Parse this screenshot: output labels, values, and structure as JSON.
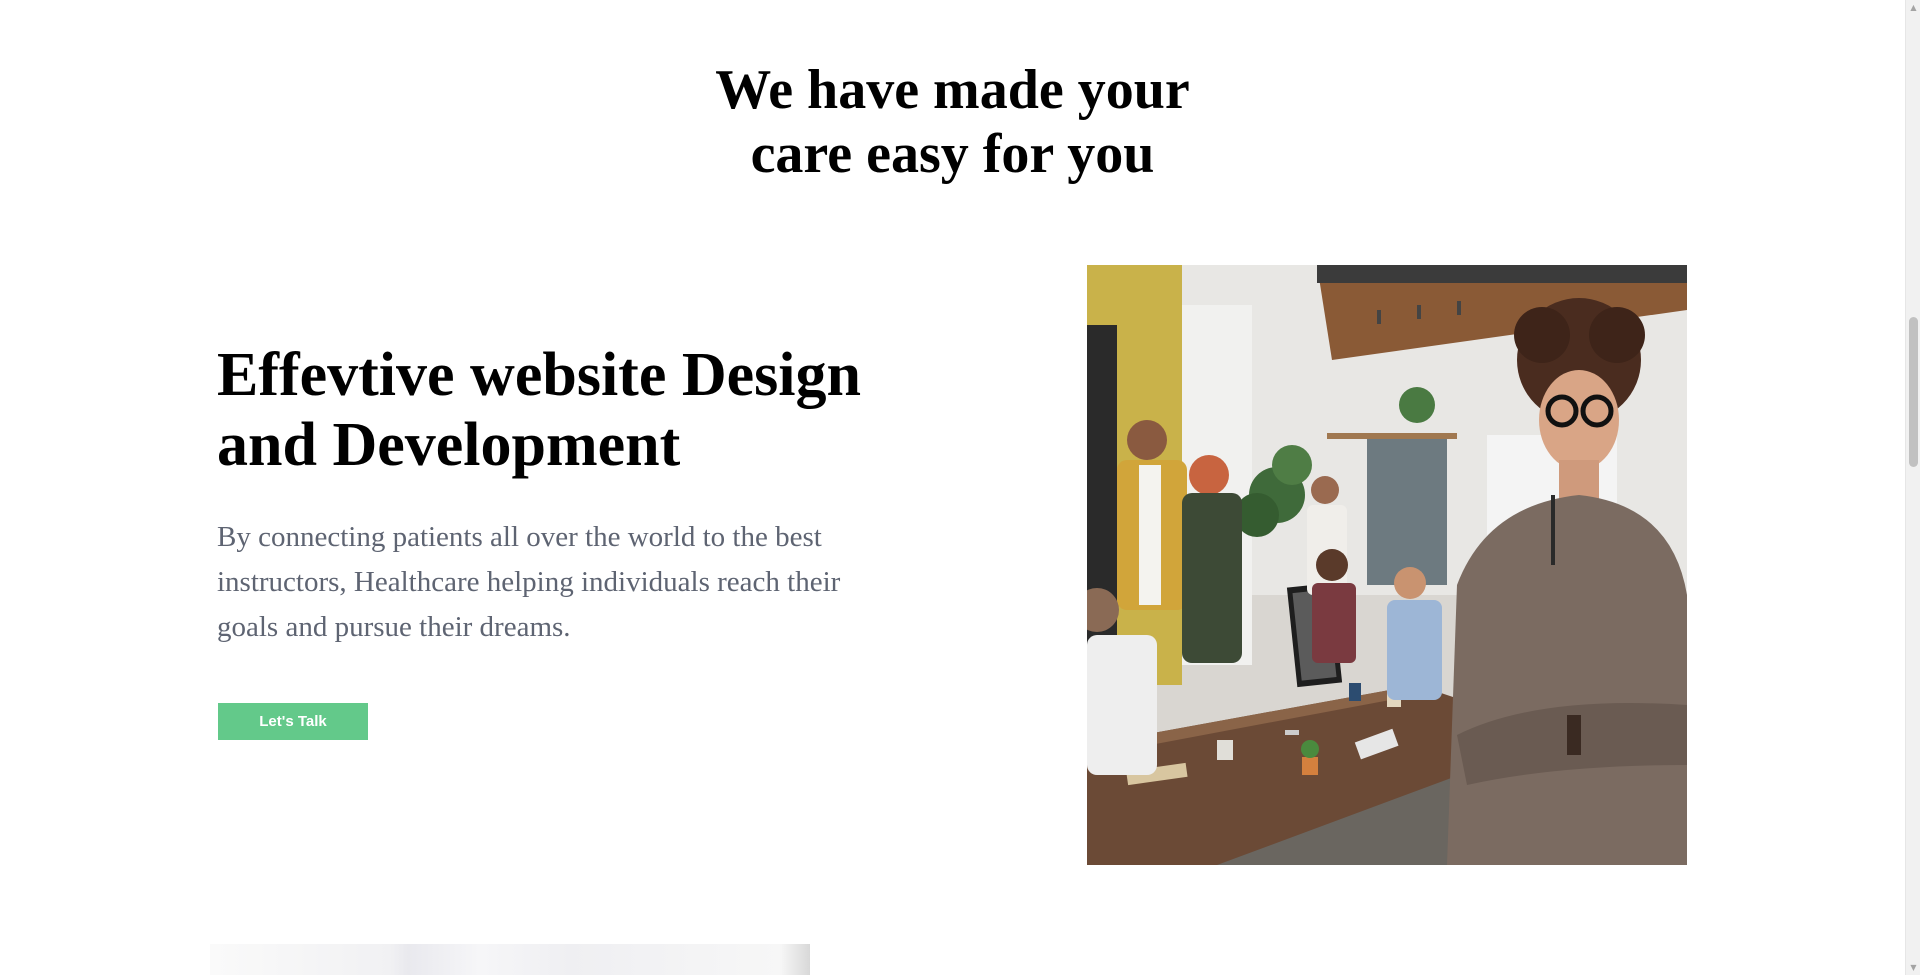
{
  "section": {
    "title_lines": [
      "We have made your",
      "care easy for you"
    ]
  },
  "feature": {
    "heading_lines": [
      "Effevtive website Design",
      "and Development"
    ],
    "description_lines": [
      "By connecting patients all over the world to the best",
      "instructors, Healthcare helping individuals reach their",
      "goals and pursue their dreams."
    ],
    "cta_label": "Let's Talk"
  },
  "images": {
    "team_photo": "team-meeting-photo",
    "next_photo": "partial-photo"
  },
  "colors": {
    "accent": "#63c98a",
    "heading": "#000000",
    "body_text": "#5e6472",
    "background": "#ffffff"
  }
}
